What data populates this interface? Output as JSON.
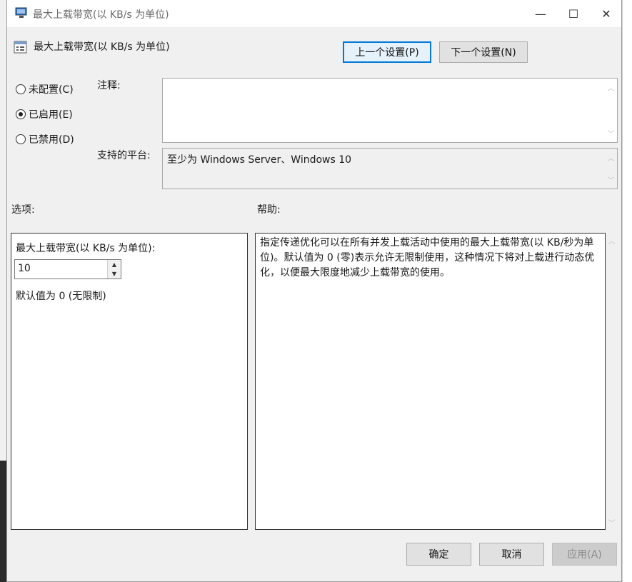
{
  "dialog": {
    "title": "最大上载带宽(以 KB/s 为单位)",
    "setting_title": "最大上载带宽(以 KB/s 为单位)",
    "window_controls": {
      "minimize": "—",
      "maximize": "☐",
      "close": "✕"
    }
  },
  "nav": {
    "prev_label": "上一个设置(P)",
    "next_label": "下一个设置(N)"
  },
  "state": {
    "options": [
      {
        "label": "未配置(C)",
        "checked": false
      },
      {
        "label": "已启用(E)",
        "checked": true
      },
      {
        "label": "已禁用(D)",
        "checked": false
      }
    ]
  },
  "comment": {
    "label": "注释:",
    "value": ""
  },
  "platform": {
    "label": "支持的平台:",
    "value": "至少为 Windows Server、Windows 10"
  },
  "options_section": {
    "label": "选项:",
    "field_label": "最大上载带宽(以 KB/s 为单位):",
    "value": "10",
    "default_note": "默认值为 0 (无限制)"
  },
  "help_section": {
    "label": "帮助:",
    "text": "指定传递优化可以在所有并发上载活动中使用的最大上载带宽(以 KB/秒为单位)。默认值为 0 (零)表示允许无限制使用，这种情况下将对上载进行动态优化，以便最大限度地减少上载带宽的使用。"
  },
  "footer": {
    "ok_label": "确定",
    "cancel_label": "取消",
    "apply_label": "应用(A)"
  },
  "colors": {
    "accent": "#0078d7",
    "dialog_bg": "#f0f0f0"
  }
}
